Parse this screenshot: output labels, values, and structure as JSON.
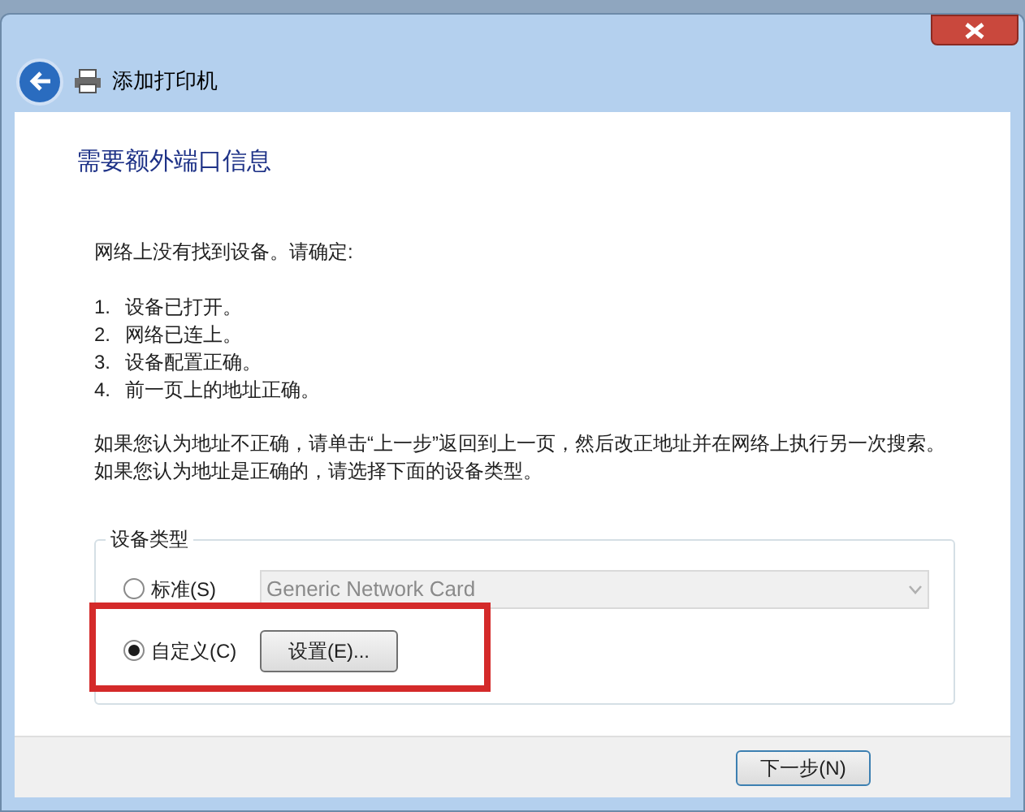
{
  "window": {
    "title": "添加打印机"
  },
  "heading": "需要额外端口信息",
  "intro": "网络上没有找到设备。请确定:",
  "checklist": [
    {
      "number": "1.",
      "text": "设备已打开。"
    },
    {
      "number": "2.",
      "text": "网络已连上。"
    },
    {
      "number": "3.",
      "text": "设备配置正确。"
    },
    {
      "number": "4.",
      "text": "前一页上的地址正确。"
    }
  ],
  "advice": "如果您认为地址不正确，请单击“上一步”返回到上一页，然后改正地址并在网络上执行另一次搜索。如果您认为地址是正确的，请选择下面的设备类型。",
  "device_type": {
    "legend": "设备类型",
    "options": [
      {
        "kind": "combo",
        "label": "标准(S)",
        "selected": false,
        "value": "Generic Network Card",
        "disabled": true
      },
      {
        "kind": "button",
        "label": "自定义(C)",
        "selected": true,
        "button": "设置(E)..."
      }
    ]
  },
  "footer": {
    "next_button": "下一步(N)"
  }
}
